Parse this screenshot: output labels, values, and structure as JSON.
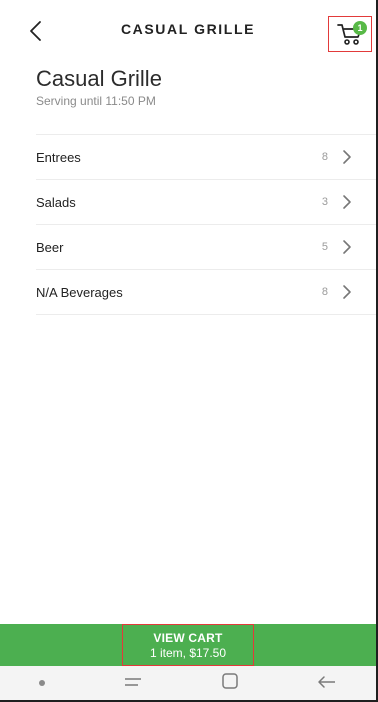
{
  "header": {
    "title": "CASUAL GRILLE",
    "cart_badge_count": "1"
  },
  "restaurant": {
    "name": "Casual Grille",
    "serving": "Serving until 11:50 PM"
  },
  "categories": [
    {
      "name": "Entrees",
      "count": "8"
    },
    {
      "name": "Salads",
      "count": "3"
    },
    {
      "name": "Beer",
      "count": "5"
    },
    {
      "name": "N/A Beverages",
      "count": "8"
    }
  ],
  "cart": {
    "label": "VIEW CART",
    "summary": "1 item, $17.50"
  },
  "icons": {
    "back": "back-chevron-icon",
    "cart": "shopping-cart-icon",
    "row": "chevron-right-icon"
  },
  "colors": {
    "accent": "#4caf50",
    "badge": "#58b947",
    "highlight": "#e23a3a"
  }
}
